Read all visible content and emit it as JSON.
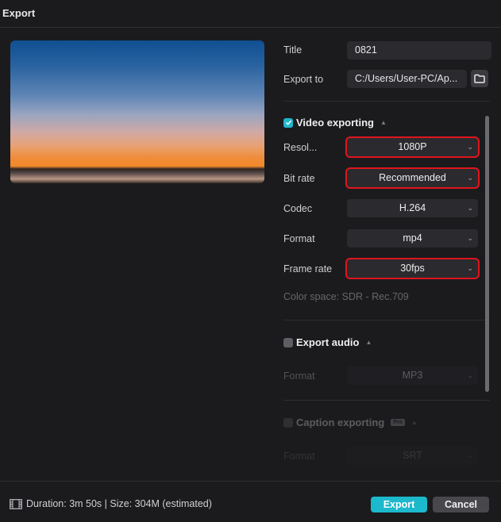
{
  "window": {
    "title": "Export"
  },
  "preview": {
    "alt": "Sunset over water preview thumbnail"
  },
  "form": {
    "title_label": "Title",
    "title_value": "0821",
    "export_to_label": "Export to",
    "export_to_value": "C:/Users/User-PC/Ap...",
    "folder_icon": "folder-icon"
  },
  "video": {
    "section_label": "Video exporting",
    "enabled": true,
    "fields": [
      {
        "label": "Resol...",
        "value": "1080P",
        "highlighted": true
      },
      {
        "label": "Bit rate",
        "value": "Recommended",
        "highlighted": true
      },
      {
        "label": "Codec",
        "value": "H.264",
        "highlighted": false
      },
      {
        "label": "Format",
        "value": "mp4",
        "highlighted": false
      },
      {
        "label": "Frame rate",
        "value": "30fps",
        "highlighted": true
      }
    ],
    "color_space": "Color space: SDR - Rec.709"
  },
  "audio": {
    "section_label": "Export audio",
    "enabled": false,
    "format_label": "Format",
    "format_value": "MP3"
  },
  "caption": {
    "section_label": "Caption exporting",
    "badge": "Pro",
    "enabled": false,
    "format_label": "Format",
    "format_value": "SRT"
  },
  "footer": {
    "info": "Duration: 3m 50s | Size: 304M (estimated)",
    "export_label": "Export",
    "cancel_label": "Cancel"
  },
  "colors": {
    "accent": "#1cb8cc",
    "highlight": "#e0141c",
    "background": "#1b1b1e",
    "field": "#2b2b2f"
  }
}
